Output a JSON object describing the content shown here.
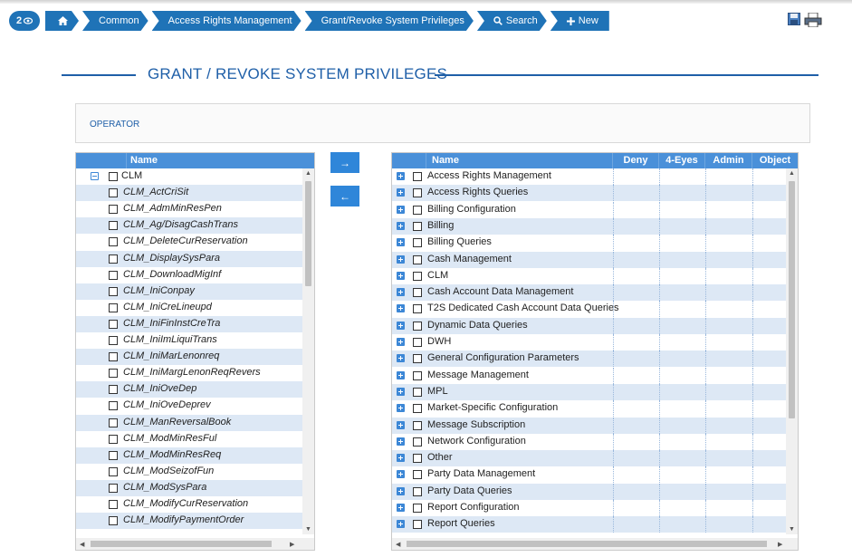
{
  "breadcrumb": {
    "badge_count": "2",
    "items": [
      "Common",
      "Access Rights Management",
      "Grant/Revoke System Privileges",
      "Search",
      "New"
    ]
  },
  "page_title": "GRANT / REVOKE SYSTEM PRIVILEGES",
  "operator_label": "OPERATOR",
  "move_buttons": {
    "right": "→",
    "left": "←"
  },
  "left_table": {
    "header": "Name",
    "group": "CLM",
    "items": [
      "CLM_ActCriSit",
      "CLM_AdmMinResPen",
      "CLM_Ag/DisagCashTrans",
      "CLM_DeleteCurReservation",
      "CLM_DisplaySysPara",
      "CLM_DownloadMigInf",
      "CLM_IniConpay",
      "CLM_IniCreLineupd",
      "CLM_IniFinInstCreTra",
      "CLM_IniImLiquiTrans",
      "CLM_IniMarLenonreq",
      "CLM_IniMargLenonReqRevers",
      "CLM_IniOveDep",
      "CLM_IniOveDeprev",
      "CLM_ManReversalBook",
      "CLM_ModMinResFul",
      "CLM_ModMinResReq",
      "CLM_ModSeizofFun",
      "CLM_ModSysPara",
      "CLM_ModifyCurReservation",
      "CLM_ModifyPaymentOrder"
    ]
  },
  "right_table": {
    "headers": [
      "Name",
      "Deny",
      "4-Eyes",
      "Admin",
      "Object"
    ],
    "items": [
      "Access Rights Management",
      "Access Rights Queries",
      "Billing Configuration",
      "Billing",
      "Billing Queries",
      "Cash Management",
      "CLM",
      "Cash Account Data Management",
      "T2S Dedicated Cash Account Data Queries",
      "Dynamic Data Queries",
      "DWH",
      "General Configuration Parameters",
      "Message Management",
      "MPL",
      "Market-Specific Configuration",
      "Message Subscription",
      "Network Configuration",
      "Other",
      "Party Data Management",
      "Party Data Queries",
      "Report Configuration",
      "Report Queries"
    ]
  },
  "colors": {
    "accent": "#1f73b7",
    "header": "#4a90d9",
    "row_alt": "#dde8f5",
    "title": "#1f5fa8"
  },
  "icons": {
    "right_tools": [
      "save-icon",
      "print-icon"
    ]
  }
}
